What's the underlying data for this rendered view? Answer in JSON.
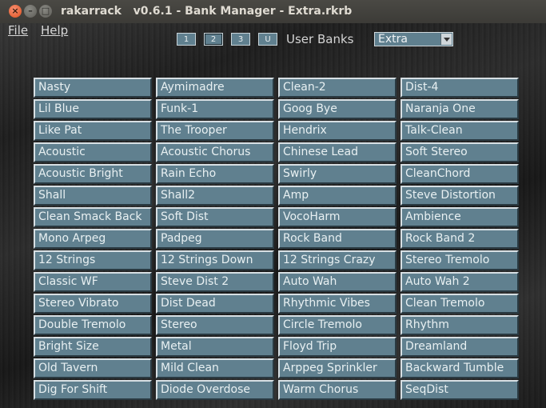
{
  "window": {
    "title": "rakarrack   v0.6.1 - Bank Manager - Extra.rkrb"
  },
  "menu": {
    "file": "File",
    "help": "Help"
  },
  "banks": {
    "buttons": [
      "1",
      "2",
      "3",
      "U"
    ],
    "active": "2",
    "label": "User Banks",
    "selected": "Extra"
  },
  "presets": [
    [
      "Nasty",
      "Aymimadre",
      "Clean-2",
      "Dist-4"
    ],
    [
      "Lil Blue",
      "Funk-1",
      "Goog Bye",
      "Naranja One"
    ],
    [
      "Like Pat",
      "The Trooper",
      "Hendrix",
      "Talk-Clean"
    ],
    [
      "Acoustic",
      "Acoustic Chorus",
      "Chinese Lead",
      "Soft Stereo"
    ],
    [
      "Acoustic Bright",
      "Rain Echo",
      "Swirly",
      "CleanChord"
    ],
    [
      "Shall",
      "Shall2",
      "Amp",
      "Steve Distortion"
    ],
    [
      "Clean Smack Back",
      "Soft Dist",
      "VocoHarm",
      "Ambience"
    ],
    [
      "Mono Arpeg",
      "Padpeg",
      "Rock Band",
      "Rock Band 2"
    ],
    [
      "12 Strings",
      "12 Strings Down",
      "12 Strings Crazy",
      "Stereo Tremolo"
    ],
    [
      "Classic WF",
      "Steve Dist 2",
      "Auto Wah",
      "Auto Wah 2"
    ],
    [
      "Stereo Vibrato",
      "Dist Dead",
      "Rhythmic Vibes",
      "Clean Tremolo"
    ],
    [
      "Double Tremolo",
      "Stereo",
      "Circle Tremolo",
      "Rhythm"
    ],
    [
      "Bright Size",
      "Metal",
      "Floyd Trip",
      "Dreamland"
    ],
    [
      "Old Tavern",
      "Mild Clean",
      "Arppeg Sprinkler",
      "Backward Tumble"
    ],
    [
      "Dig For Shift",
      "Diode Overdose",
      "Warm Chorus",
      "SeqDist"
    ]
  ],
  "colors": {
    "button_bg": "#60808f",
    "close_button": "#e0501e"
  }
}
